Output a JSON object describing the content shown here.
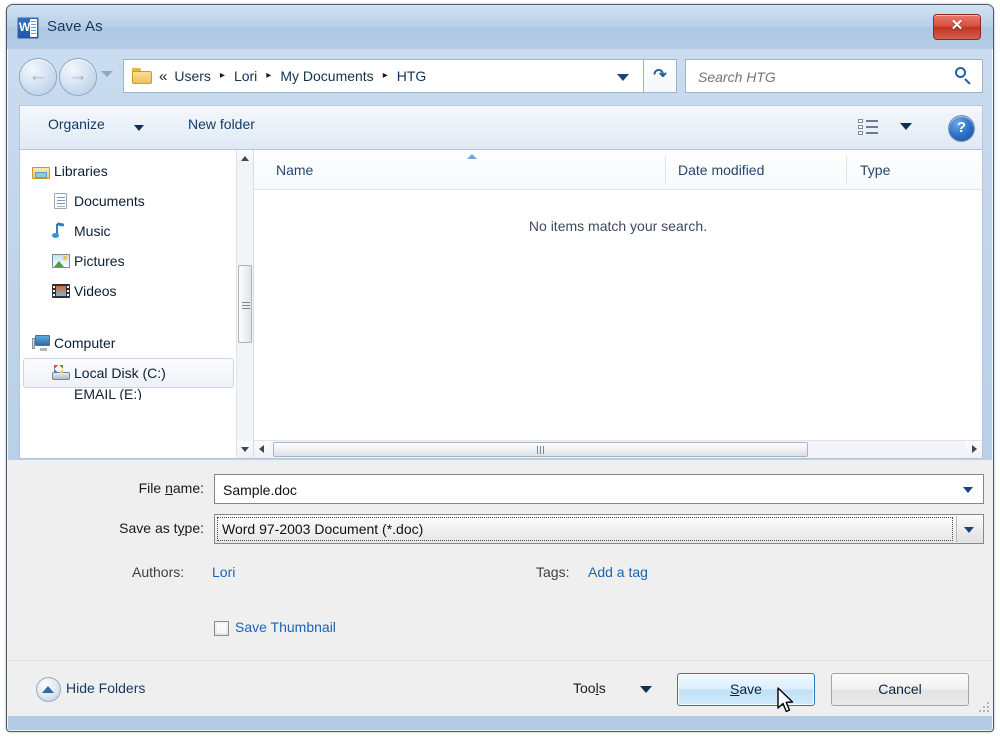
{
  "window": {
    "title": "Save As",
    "app_icon": "word-icon",
    "close_label": "✕"
  },
  "navbar": {
    "back_icon": "arrow-left-icon",
    "forward_icon": "arrow-right-icon",
    "history_icon": "chevron-down-icon",
    "folder_icon": "folder-icon",
    "overflow": "«",
    "breadcrumbs": [
      "Users",
      "Lori",
      "My Documents",
      "HTG"
    ],
    "separator": "▸",
    "refresh_icon": "refresh-icon",
    "refresh_glyph": "↺",
    "search": {
      "placeholder": "Search HTG",
      "value": "",
      "icon": "search-icon"
    }
  },
  "commandbar": {
    "organize_label": "Organize",
    "new_folder_label": "New folder",
    "view_icon": "list-view-icon",
    "help_icon": "help-icon",
    "help_glyph": "?"
  },
  "sidebar": {
    "items": [
      {
        "label": "Libraries",
        "icon": "libraries-icon",
        "level": "root",
        "selected": false
      },
      {
        "label": "Documents",
        "icon": "documents-icon",
        "level": "child",
        "selected": false
      },
      {
        "label": "Music",
        "icon": "music-icon",
        "level": "child",
        "selected": false
      },
      {
        "label": "Pictures",
        "icon": "pictures-icon",
        "level": "child",
        "selected": false
      },
      {
        "label": "Videos",
        "icon": "videos-icon",
        "level": "child",
        "selected": false
      },
      {
        "label": "Computer",
        "icon": "computer-icon",
        "level": "root",
        "selected": false
      },
      {
        "label": "Local Disk (C:)",
        "icon": "disk-icon",
        "level": "child",
        "selected": true
      },
      {
        "label": "EMAIL (E:)",
        "icon": "disk-icon",
        "level": "child",
        "selected": false
      }
    ]
  },
  "filelist": {
    "columns": [
      "Name",
      "Date modified",
      "Type"
    ],
    "sort_column": "Name",
    "sort_direction": "ascending",
    "rows": [],
    "empty_message": "No items match your search."
  },
  "form": {
    "filename_label": "File name:",
    "filename_accesskey": "n",
    "filename_value": "Sample.doc",
    "filetype_label": "Save as type:",
    "filetype_accesskey": "y",
    "filetype_value": "Word 97-2003 Document (*.doc)",
    "authors_label": "Authors:",
    "authors_value": "Lori",
    "tags_label": "Tags:",
    "tags_value": "Add a tag",
    "thumbnail_label": "Save Thumbnail",
    "thumbnail_checked": false
  },
  "actions": {
    "hide_folders_label": "Hide Folders",
    "hide_folders_icon": "chevron-up-circle-icon",
    "tools_label": "Tools",
    "tools_accesskey": "l",
    "save_label": "Save",
    "save_accesskey": "S",
    "cancel_label": "Cancel",
    "cursor_icon": "mouse-pointer-icon"
  },
  "colors": {
    "titlebar": "#b4cbe6",
    "accent_link": "#1964b4",
    "close_button": "#c03425",
    "save_border": "#2f76c0",
    "panel": "#efefef"
  }
}
